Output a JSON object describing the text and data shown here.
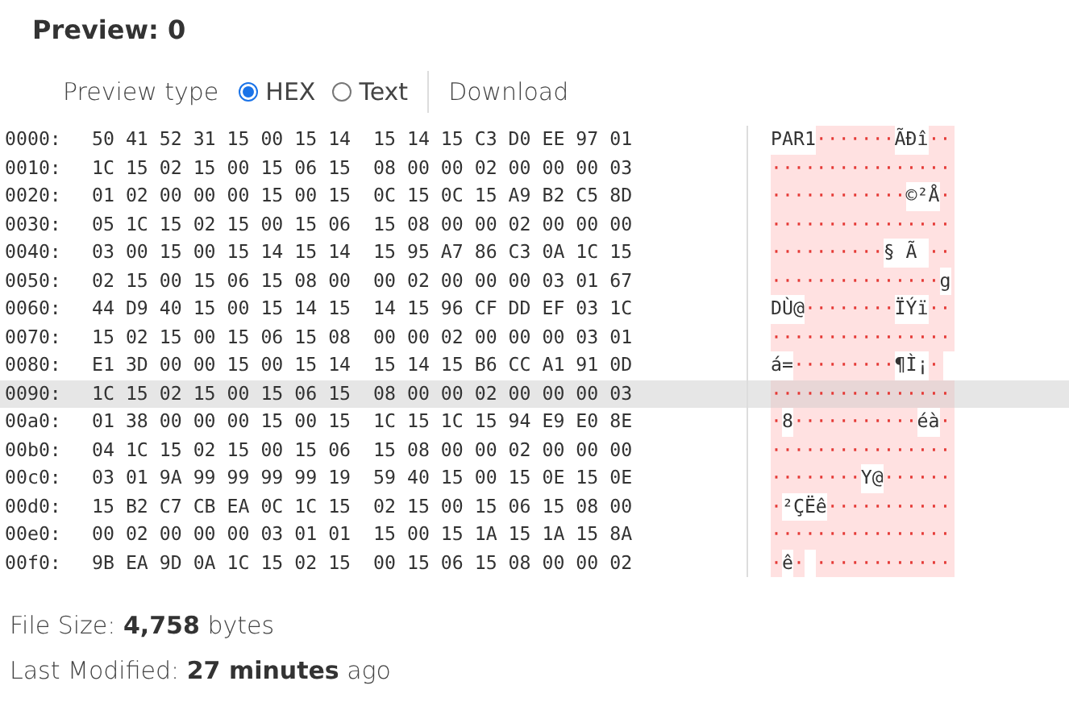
{
  "title": "Preview: 0",
  "preview_type": {
    "label": "Preview type",
    "options": [
      {
        "label": "HEX",
        "selected": true
      },
      {
        "label": "Text",
        "selected": false
      }
    ]
  },
  "download": "Download",
  "rows": [
    {
      "offset": "0000:",
      "bytes": [
        "50 41 52 31 15 00 15 14",
        "15 14 15 C3 D0 EE 97 01"
      ],
      "highlighted": false,
      "ascii": [
        {
          "kind": "printable",
          "text": "PAR1"
        },
        {
          "kind": "unprintable",
          "text": "·······"
        },
        {
          "kind": "printable",
          "text": "ÃÐî"
        },
        {
          "kind": "unprintable",
          "text": "··"
        }
      ]
    },
    {
      "offset": "0010:",
      "bytes": [
        "1C 15 02 15 00 15 06 15",
        "08 00 00 02 00 00 00 03"
      ],
      "highlighted": false,
      "ascii": [
        {
          "kind": "unprintable",
          "text": "················"
        }
      ]
    },
    {
      "offset": "0020:",
      "bytes": [
        "01 02 00 00 00 15 00 15",
        "0C 15 0C 15 A9 B2 C5 8D"
      ],
      "highlighted": false,
      "ascii": [
        {
          "kind": "unprintable",
          "text": "············"
        },
        {
          "kind": "printable",
          "text": "©²Å"
        },
        {
          "kind": "unprintable",
          "text": "·"
        }
      ]
    },
    {
      "offset": "0030:",
      "bytes": [
        "05 1C 15 02 15 00 15 06",
        "15 08 00 00 02 00 00 00"
      ],
      "highlighted": false,
      "ascii": [
        {
          "kind": "unprintable",
          "text": "················"
        }
      ]
    },
    {
      "offset": "0040:",
      "bytes": [
        "03 00 15 00 15 14 15 14",
        "15 95 A7 86 C3 0A 1C 15"
      ],
      "highlighted": false,
      "ascii": [
        {
          "kind": "unprintable",
          "text": "··········"
        },
        {
          "kind": "printable",
          "text": "§ Ã "
        },
        {
          "kind": "unprintable",
          "text": "··"
        }
      ]
    },
    {
      "offset": "0050:",
      "bytes": [
        "02 15 00 15 06 15 08 00",
        "00 02 00 00 00 03 01 67"
      ],
      "highlighted": false,
      "ascii": [
        {
          "kind": "unprintable",
          "text": "···············"
        },
        {
          "kind": "printable",
          "text": "g"
        }
      ]
    },
    {
      "offset": "0060:",
      "bytes": [
        "44 D9 40 15 00 15 14 15",
        "14 15 96 CF DD EF 03 1C"
      ],
      "highlighted": false,
      "ascii": [
        {
          "kind": "printable",
          "text": "DÙ@"
        },
        {
          "kind": "unprintable",
          "text": "········"
        },
        {
          "kind": "printable",
          "text": "ÏÝï"
        },
        {
          "kind": "unprintable",
          "text": "··"
        }
      ]
    },
    {
      "offset": "0070:",
      "bytes": [
        "15 02 15 00 15 06 15 08",
        "00 00 02 00 00 00 03 01"
      ],
      "highlighted": false,
      "ascii": [
        {
          "kind": "unprintable",
          "text": "················"
        }
      ]
    },
    {
      "offset": "0080:",
      "bytes": [
        "E1 3D 00 00 15 00 15 14",
        "15 14 15 B6 CC A1 91 0D"
      ],
      "highlighted": false,
      "ascii": [
        {
          "kind": "printable",
          "text": "á="
        },
        {
          "kind": "unprintable",
          "text": "·········"
        },
        {
          "kind": "printable",
          "text": "¶Ì¡"
        },
        {
          "kind": "unprintable",
          "text": "·"
        }
      ]
    },
    {
      "offset": "0090:",
      "bytes": [
        "1C 15 02 15 00 15 06 15",
        "08 00 00 02 00 00 00 03"
      ],
      "highlighted": true,
      "ascii": [
        {
          "kind": "unprintable",
          "text": "················"
        }
      ]
    },
    {
      "offset": "00a0:",
      "bytes": [
        "01 38 00 00 00 15 00 15",
        "1C 15 1C 15 94 E9 E0 8E"
      ],
      "highlighted": false,
      "ascii": [
        {
          "kind": "unprintable",
          "text": "·"
        },
        {
          "kind": "printable",
          "text": "8"
        },
        {
          "kind": "unprintable",
          "text": "···········"
        },
        {
          "kind": "printable",
          "text": "éà"
        },
        {
          "kind": "unprintable",
          "text": "·"
        }
      ]
    },
    {
      "offset": "00b0:",
      "bytes": [
        "04 1C 15 02 15 00 15 06",
        "15 08 00 00 02 00 00 00"
      ],
      "highlighted": false,
      "ascii": [
        {
          "kind": "unprintable",
          "text": "················"
        }
      ]
    },
    {
      "offset": "00c0:",
      "bytes": [
        "03 01 9A 99 99 99 99 19",
        "59 40 15 00 15 0E 15 0E"
      ],
      "highlighted": false,
      "ascii": [
        {
          "kind": "unprintable",
          "text": "········"
        },
        {
          "kind": "printable",
          "text": "Y@"
        },
        {
          "kind": "unprintable",
          "text": "······"
        }
      ]
    },
    {
      "offset": "00d0:",
      "bytes": [
        "15 B2 C7 CB EA 0C 1C 15",
        "02 15 00 15 06 15 08 00"
      ],
      "highlighted": false,
      "ascii": [
        {
          "kind": "unprintable",
          "text": "·"
        },
        {
          "kind": "printable",
          "text": "²ÇËê"
        },
        {
          "kind": "unprintable",
          "text": "···········"
        }
      ]
    },
    {
      "offset": "00e0:",
      "bytes": [
        "00 02 00 00 00 03 01 01",
        "15 00 15 1A 15 1A 15 8A"
      ],
      "highlighted": false,
      "ascii": [
        {
          "kind": "unprintable",
          "text": "················"
        }
      ]
    },
    {
      "offset": "00f0:",
      "bytes": [
        "9B EA 9D 0A 1C 15 02 15",
        "00 15 06 15 08 00 00 02"
      ],
      "highlighted": false,
      "ascii": [
        {
          "kind": "unprintable",
          "text": "·"
        },
        {
          "kind": "printable",
          "text": "ê"
        },
        {
          "kind": "unprintable",
          "text": "·"
        },
        {
          "kind": "blank"
        },
        {
          "kind": "unprintable",
          "text": "············"
        }
      ]
    }
  ],
  "info": [
    {
      "text": "File Size: **4,758** bytes"
    },
    {
      "text": "Last Modified: **27 minutes** ago"
    }
  ]
}
